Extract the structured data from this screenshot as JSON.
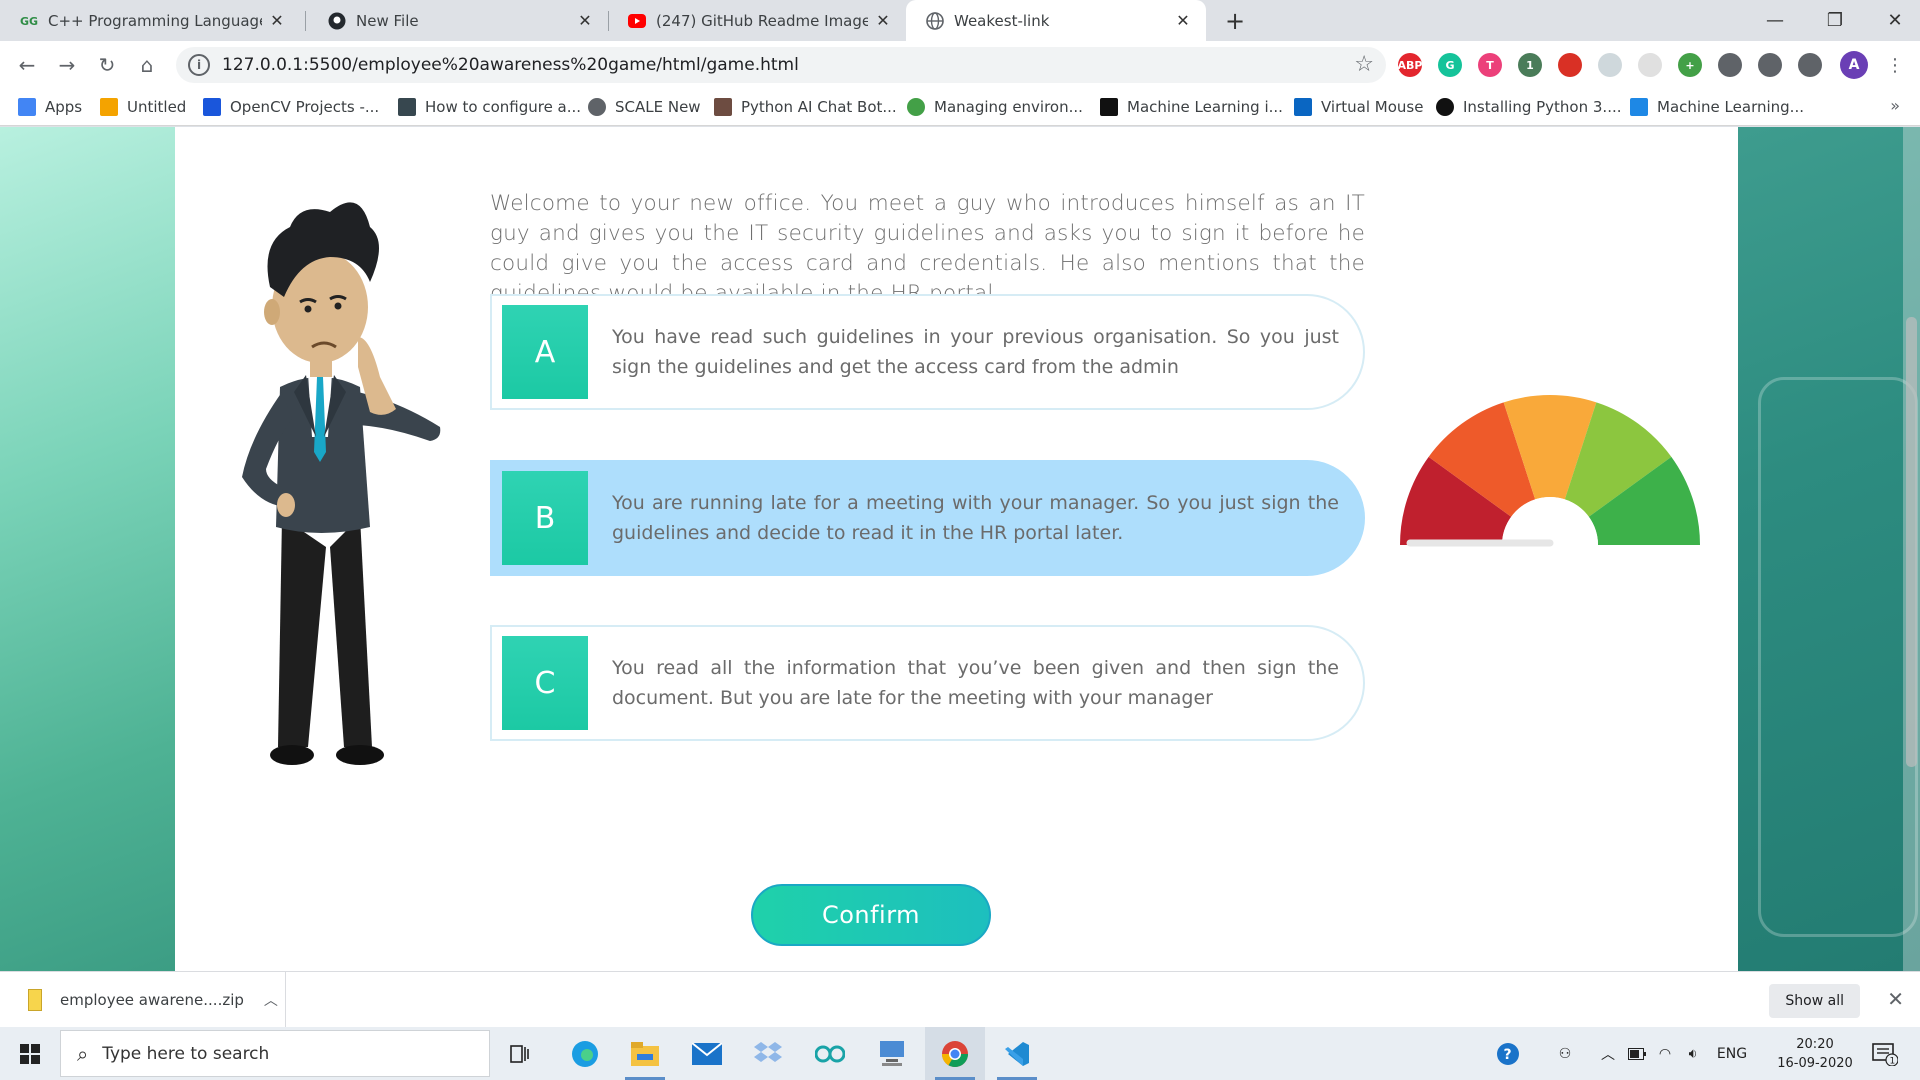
{
  "browser": {
    "tabs": [
      {
        "title": "C++ Programming Language - G",
        "favicon": "geeksforgeeks-icon",
        "active": false
      },
      {
        "title": "New File",
        "favicon": "github-icon",
        "active": false
      },
      {
        "title": "(247) GitHub Readme Images Tut",
        "favicon": "youtube-icon",
        "active": false
      },
      {
        "title": "Weakest-link",
        "favicon": "globe-icon",
        "active": true
      }
    ],
    "url": "127.0.0.1:5500/employee%20awareness%20game/html/game.html",
    "profile_initial": "A",
    "extensions": [
      {
        "label": "ABP",
        "color": "#e3262e"
      },
      {
        "label": "G",
        "color": "#15c39a"
      },
      {
        "label": "T",
        "color": "#ec407a"
      },
      {
        "label": "1",
        "color": "#4a7c59"
      },
      {
        "label": "",
        "color": "#d93025"
      },
      {
        "label": "",
        "color": "#cfd8dc"
      },
      {
        "label": "",
        "color": "#e0e0e0"
      },
      {
        "label": "+",
        "color": "#43a047"
      },
      {
        "label": "",
        "color": "#5f6368"
      },
      {
        "label": "",
        "color": "#5f6368"
      },
      {
        "label": "",
        "color": "#5f6368"
      }
    ]
  },
  "bookmarks": [
    {
      "label": "Apps",
      "icon": "apps-grid-icon",
      "color": "#4285f4"
    },
    {
      "label": "Untitled",
      "icon": "bookmark-icon",
      "color": "#f4a300"
    },
    {
      "label": "OpenCV Projects -...",
      "icon": "ps-icon",
      "color": "#1a56db"
    },
    {
      "label": "How to configure a...",
      "icon": "page-icon",
      "color": "#37474f"
    },
    {
      "label": "SCALE New",
      "icon": "globe-icon",
      "color": "#5f6368"
    },
    {
      "label": "Python AI Chat Bot...",
      "icon": "page-icon",
      "color": "#6d4c41"
    },
    {
      "label": "Managing environ...",
      "icon": "circle-icon",
      "color": "#43a047"
    },
    {
      "label": "Machine Learning i...",
      "icon": "medium-icon",
      "color": "#111111"
    },
    {
      "label": "Virtual Mouse",
      "icon": "linkedin-icon",
      "color": "#0a66c2"
    },
    {
      "label": "Installing Python 3....",
      "icon": "github-icon",
      "color": "#111111"
    },
    {
      "label": "Machine Learning...",
      "icon": "s-icon",
      "color": "#1e88e5"
    }
  ],
  "game": {
    "question": "Welcome to your new office. You meet a guy who introduces himself as an IT guy and gives you the IT security guidelines and asks you to sign it before he could give you the access card and credentials. He also mentions that the guidelines would be available in the HR portal",
    "options": [
      {
        "letter": "A",
        "text": "You have read such guidelines in your previous organisation. So you just sign the guidelines and get the access card from the admin",
        "selected": false
      },
      {
        "letter": "B",
        "text": "You are running late for a meeting with your manager. So you just sign the guidelines and decide to read it in the HR portal later.",
        "selected": true
      },
      {
        "letter": "C",
        "text": "You read all the information that you’ve been given and then sign the document. But you are late for the meeting with your manager",
        "selected": false
      }
    ],
    "confirm_label": "Confirm",
    "gauge": {
      "segment_colors": [
        "#c0202e",
        "#ee5a2a",
        "#f9a93a",
        "#8cc63f",
        "#3db14a"
      ],
      "needle_level": 0
    }
  },
  "downloads": {
    "file_name": "employee awarene....zip",
    "show_all_label": "Show all"
  },
  "taskbar": {
    "search_placeholder": "Type here to search",
    "language": "ENG",
    "time": "20:20",
    "date": "16-09-2020",
    "notification_count": "1"
  }
}
